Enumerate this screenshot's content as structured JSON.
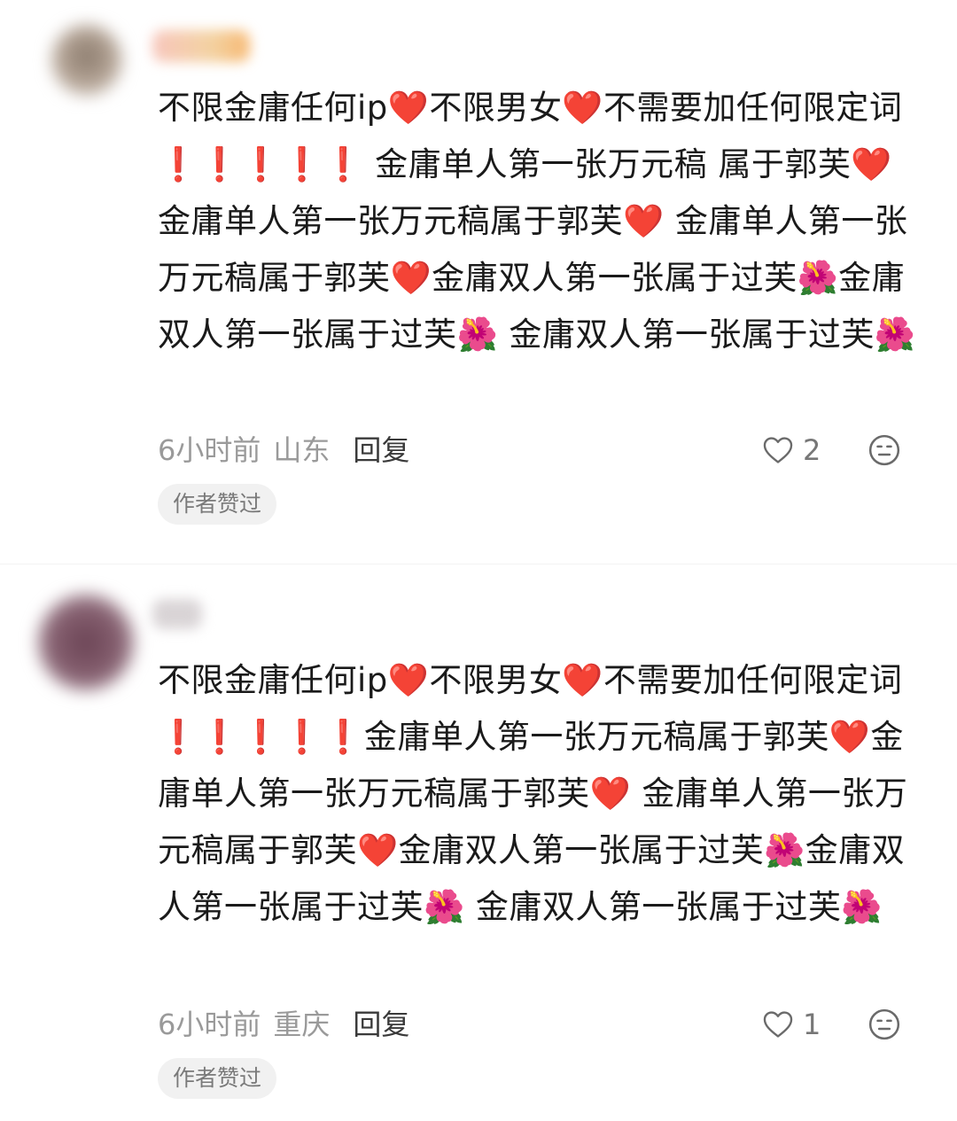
{
  "comments": [
    {
      "text": "不限金庸任何ip❤️不限男女❤️不需要加任何限定词❗❗❗❗❗ 金庸单人第一张万元稿 属于郭芙❤️金庸单人第一张万元稿属于郭芙❤️ 金庸单人第一张万元稿属于郭芙❤️金庸双人第一张属于过芙🌺金庸双人第一张属于过芙🌺 金庸双人第一张属于过芙🌺",
      "time": "6小时前",
      "location": "山东",
      "reply_label": "回复",
      "likes": "2",
      "badge": "作者赞过",
      "avatar_color": "#8a7a6c",
      "name_color": "#f3a58d"
    },
    {
      "text": "不限金庸任何ip❤️不限男女❤️不需要加任何限定词❗❗❗❗❗金庸单人第一张万元稿属于郭芙❤️金庸单人第一张万元稿属于郭芙❤️ 金庸单人第一张万元稿属于郭芙❤️金庸双人第一张属于过芙🌺金庸双人第一张属于过芙🌺 金庸双人第一张属于过芙🌺",
      "time": "6小时前",
      "location": "重庆",
      "reply_label": "回复",
      "likes": "1",
      "badge": "作者赞过",
      "avatar_color": "#6b4455",
      "name_color": "#d9d4d6"
    }
  ],
  "icons": {
    "like": "heart-outline-icon",
    "dislike": "meh-face-icon"
  }
}
